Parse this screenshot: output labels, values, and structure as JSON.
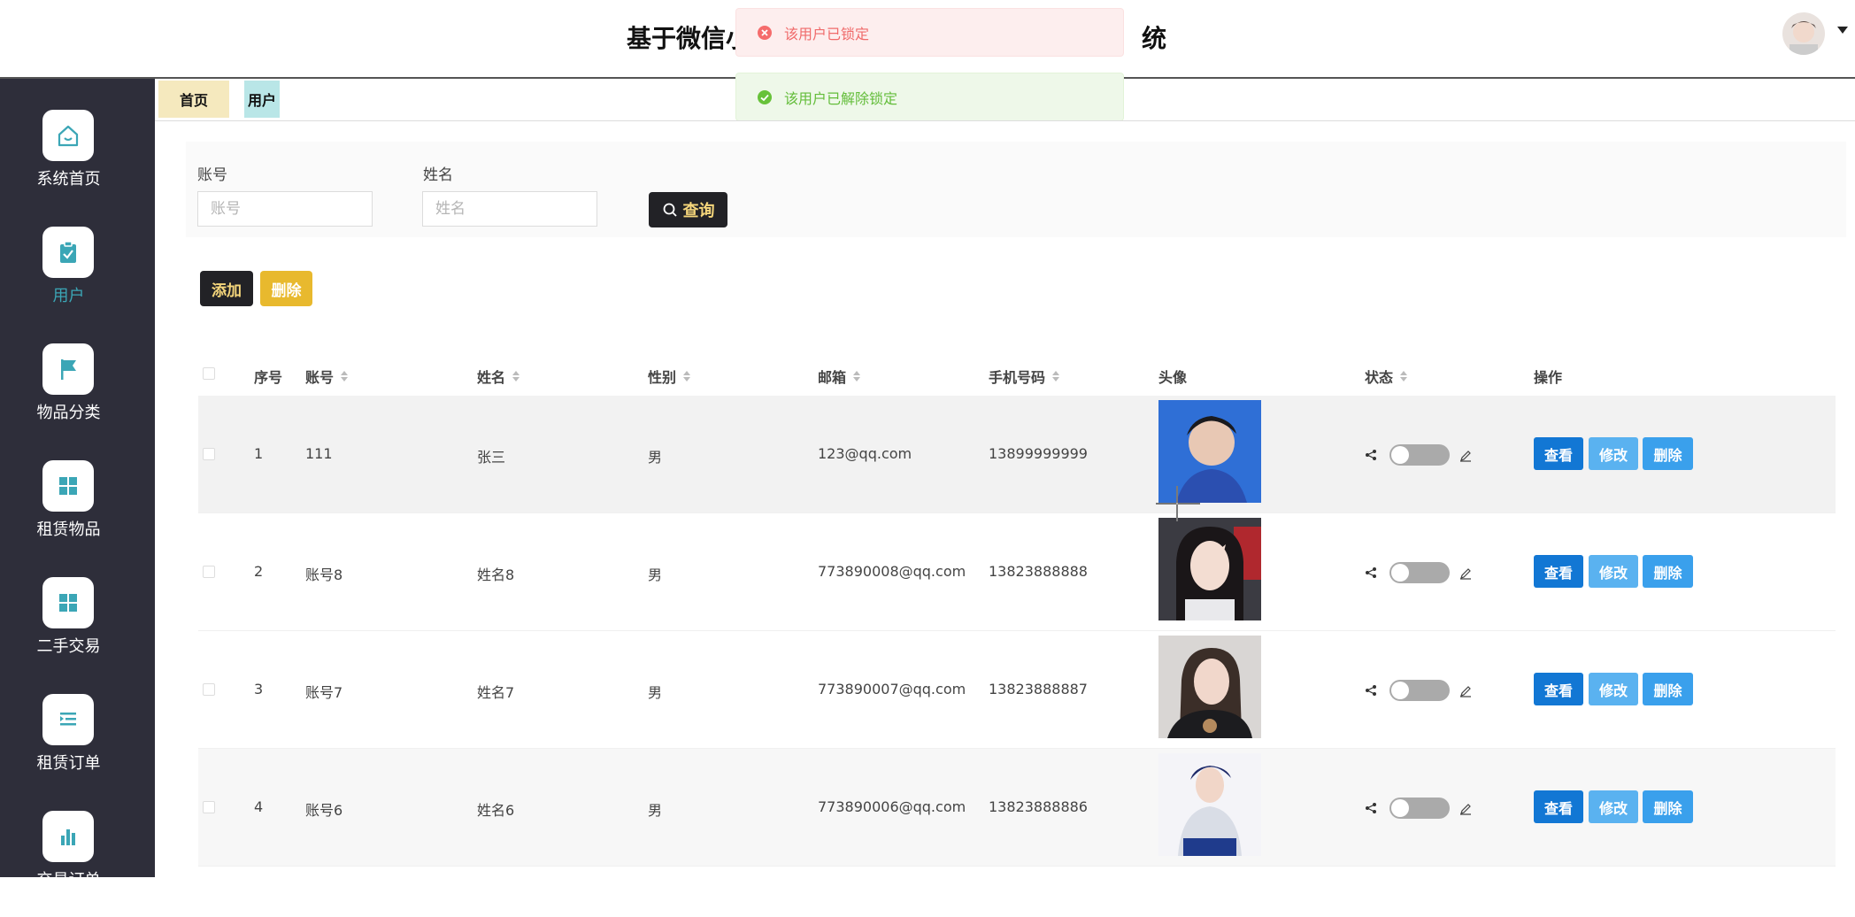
{
  "header": {
    "title_left": "基于微信小",
    "title_right": "统"
  },
  "toasts": {
    "error": "该用户已锁定",
    "success": "该用户已解除锁定"
  },
  "sidebar": {
    "items": [
      {
        "label": "系统首页",
        "icon": "home-icon"
      },
      {
        "label": "用户",
        "icon": "clipboard-check-icon",
        "active": true
      },
      {
        "label": "物品分类",
        "icon": "flag-icon"
      },
      {
        "label": "租赁物品",
        "icon": "grid-icon"
      },
      {
        "label": "二手交易",
        "icon": "grid-icon"
      },
      {
        "label": "租赁订单",
        "icon": "list-indent-icon"
      },
      {
        "label": "交易订单",
        "icon": "bar-chart-icon"
      }
    ]
  },
  "tabs": [
    {
      "label": "首页"
    },
    {
      "label": "用户"
    }
  ],
  "search": {
    "account_label": "账号",
    "account_placeholder": "账号",
    "name_label": "姓名",
    "name_placeholder": "姓名",
    "query_label": "查询"
  },
  "toolbar": {
    "add_label": "添加",
    "delete_label": "删除"
  },
  "table": {
    "columns": [
      "序号",
      "账号",
      "姓名",
      "性别",
      "邮箱",
      "手机号码",
      "头像",
      "状态",
      "操作"
    ],
    "rows": [
      {
        "index": "1",
        "account": "111",
        "name": "张三",
        "gender": "男",
        "email": "123@qq.com",
        "phone": "13899999999"
      },
      {
        "index": "2",
        "account": "账号8",
        "name": "姓名8",
        "gender": "男",
        "email": "773890008@qq.com",
        "phone": "13823888888"
      },
      {
        "index": "3",
        "account": "账号7",
        "name": "姓名7",
        "gender": "男",
        "email": "773890007@qq.com",
        "phone": "13823888887"
      },
      {
        "index": "4",
        "account": "账号6",
        "name": "姓名6",
        "gender": "男",
        "email": "773890006@qq.com",
        "phone": "13823888886"
      }
    ],
    "actions": {
      "view": "查看",
      "edit": "修改",
      "delete": "删除"
    }
  },
  "colors": {
    "sidebar_bg": "#2e2e3a",
    "accent_teal": "#3ba6b6",
    "primary_dark": "#222226",
    "gold": "#e8b92e",
    "blue_view": "#1277d4",
    "blue_edit": "#5ab2f0",
    "blue_delete": "#3aa0ec"
  }
}
